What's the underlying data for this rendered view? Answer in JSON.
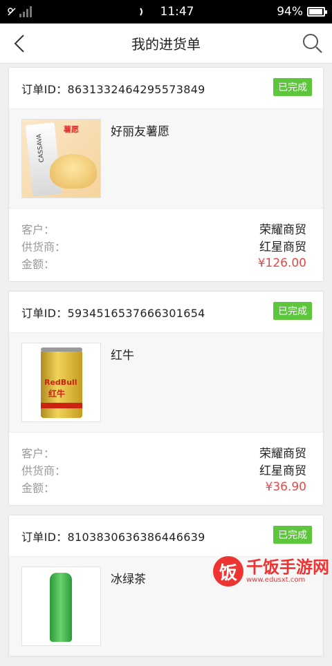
{
  "status_bar": {
    "time": "11:47",
    "battery": "94%"
  },
  "header": {
    "title": "我的进货单"
  },
  "orders": [
    {
      "order_id_label": "订单ID：8631332464295573849",
      "status": "已完成",
      "product_name": "好丽友薯愿",
      "customer_label": "客户：",
      "customer": "荣耀商贸",
      "supplier_label": "供货商：",
      "supplier": "红星商贸",
      "amount_label": "金额：",
      "amount": "¥126.00"
    },
    {
      "order_id_label": "订单ID：5934516537666301654",
      "status": "已完成",
      "product_name": "红牛",
      "customer_label": "客户：",
      "customer": "荣耀商贸",
      "supplier_label": "供货商：",
      "supplier": "红星商贸",
      "amount_label": "金额：",
      "amount": "¥36.90"
    },
    {
      "order_id_label": "订单ID：8103830636386446639",
      "status": "已完成",
      "product_name": "冰绿茶"
    }
  ],
  "colors": {
    "status_green": "#5dc63c",
    "amount_red": "#e04a4a"
  },
  "watermark": {
    "logo": "饭",
    "title": "千饭手游网",
    "url": "www.edusxt.com"
  }
}
